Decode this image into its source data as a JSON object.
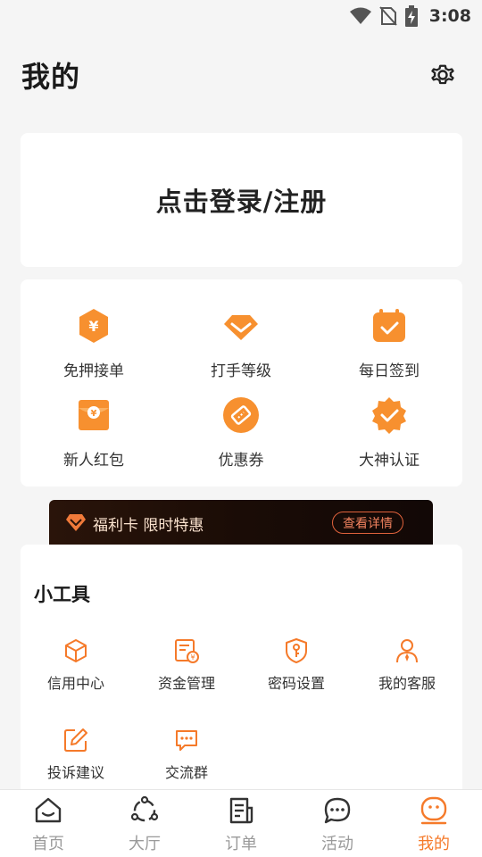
{
  "status_bar": {
    "time": "3:08",
    "icons": [
      "wifi-icon",
      "no-sim-icon",
      "battery-charging-icon"
    ]
  },
  "header": {
    "title": "我的",
    "settings_icon": "gear-icon"
  },
  "login": {
    "text": "点击登录/注册"
  },
  "features": [
    {
      "label": "免押接单",
      "icon": "shield-yen-icon"
    },
    {
      "label": "打手等级",
      "icon": "diamond-icon"
    },
    {
      "label": "每日签到",
      "icon": "calendar-check-icon"
    },
    {
      "label": "新人红包",
      "icon": "red-envelope-icon"
    },
    {
      "label": "优惠券",
      "icon": "coupon-icon"
    },
    {
      "label": "大神认证",
      "icon": "certified-badge-icon"
    }
  ],
  "promo": {
    "text": "福利卡 限时特惠",
    "button": "查看详情",
    "icon": "gem-icon"
  },
  "tools": {
    "title": "小工具",
    "items": [
      {
        "label": "信用中心",
        "icon": "cube-icon"
      },
      {
        "label": "资金管理",
        "icon": "money-doc-icon"
      },
      {
        "label": "密码设置",
        "icon": "key-shield-icon"
      },
      {
        "label": "我的客服",
        "icon": "customer-service-icon"
      },
      {
        "label": "投诉建议",
        "icon": "edit-icon"
      },
      {
        "label": "交流群",
        "icon": "chat-dots-icon"
      }
    ]
  },
  "bottom_nav": {
    "items": [
      {
        "label": "首页",
        "icon": "home-icon"
      },
      {
        "label": "大厅",
        "icon": "hall-icon"
      },
      {
        "label": "订单",
        "icon": "order-icon"
      },
      {
        "label": "活动",
        "icon": "chat-bubble-icon"
      },
      {
        "label": "我的",
        "icon": "smiley-icon"
      }
    ],
    "active": "我的"
  },
  "colors": {
    "accent": "#f57a2a",
    "background": "#f5f5f5",
    "card": "#ffffff",
    "promo_bg": "#1e0e07",
    "promo_accent": "#e0623c"
  }
}
